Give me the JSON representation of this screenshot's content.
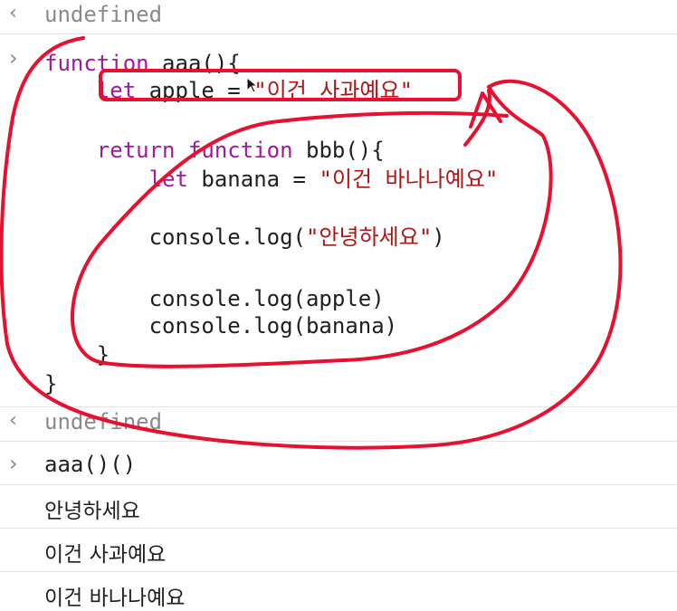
{
  "console": {
    "result_top": "undefined",
    "code_lines": [
      {
        "parts": [
          {
            "t": "function",
            "c": "kw"
          },
          {
            "t": " aaa(){",
            "c": ""
          }
        ]
      },
      {
        "parts": [
          {
            "t": "    let",
            "c": "kw"
          },
          {
            "t": " apple = ",
            "c": ""
          },
          {
            "t": "\"이건 사과예요\"",
            "c": "str"
          }
        ]
      },
      {
        "parts": []
      },
      {
        "parts": [
          {
            "t": "    return function",
            "c": "kw"
          },
          {
            "t": " bbb(){",
            "c": ""
          }
        ]
      },
      {
        "parts": [
          {
            "t": "        let",
            "c": "kw"
          },
          {
            "t": " banana = ",
            "c": ""
          },
          {
            "t": "\"이건 바나나예요\"",
            "c": "str"
          }
        ]
      },
      {
        "parts": []
      },
      {
        "parts": [
          {
            "t": "        console.log(",
            "c": ""
          },
          {
            "t": "\"안녕하세요\"",
            "c": "str"
          },
          {
            "t": ")",
            "c": ""
          }
        ]
      },
      {
        "parts": []
      },
      {
        "parts": [
          {
            "t": "        console.log(apple)",
            "c": ""
          }
        ]
      },
      {
        "parts": [
          {
            "t": "        console.log(banana)",
            "c": ""
          }
        ]
      },
      {
        "parts": [
          {
            "t": "    }",
            "c": ""
          }
        ]
      },
      {
        "parts": [
          {
            "t": "}",
            "c": ""
          }
        ]
      }
    ],
    "result_after_code": "undefined",
    "command": "aaa()()",
    "outputs": [
      "안녕하세요",
      "이건 사과예요",
      "이건 바나나예요"
    ],
    "icons": {
      "input_prompt": "chevron-right-icon",
      "result_prompt": "return-arrow-icon"
    },
    "colors": {
      "keyword": "#a1199e",
      "string": "#b01515",
      "annotation": "#e8102e"
    }
  }
}
